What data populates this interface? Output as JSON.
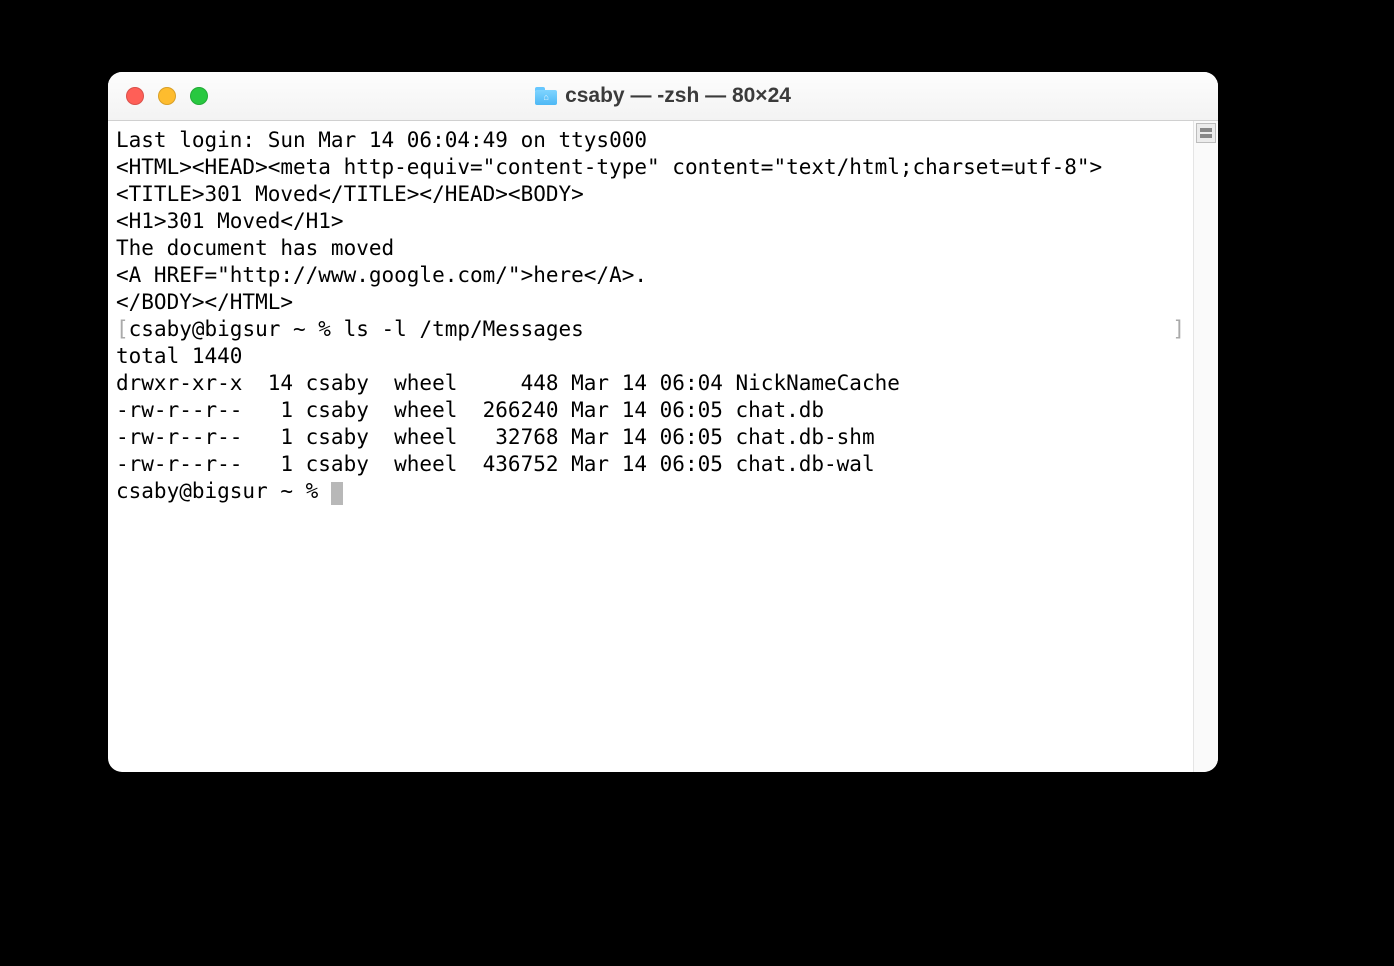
{
  "window": {
    "title": "csaby — -zsh — 80×24"
  },
  "terminal": {
    "lines": {
      "l0": "Last login: Sun Mar 14 06:04:49 on ttys000",
      "l1": "<HTML><HEAD><meta http-equiv=\"content-type\" content=\"text/html;charset=utf-8\">",
      "l2": "<TITLE>301 Moved</TITLE></HEAD><BODY>",
      "l3": "<H1>301 Moved</H1>",
      "l4": "The document has moved",
      "l5": "<A HREF=\"http://www.google.com/\">here</A>.",
      "l6": "</BODY></HTML>",
      "l7_prompt": "csaby@bigsur ~ % ",
      "l7_cmd": "ls -l /tmp/Messages",
      "l8": "total 1440",
      "l9": "drwxr-xr-x  14 csaby  wheel     448 Mar 14 06:04 NickNameCache",
      "l10": "-rw-r--r--   1 csaby  wheel  266240 Mar 14 06:05 chat.db",
      "l11": "-rw-r--r--   1 csaby  wheel   32768 Mar 14 06:05 chat.db-shm",
      "l12": "-rw-r--r--   1 csaby  wheel  436752 Mar 14 06:05 chat.db-wal",
      "l13_prompt": "csaby@bigsur ~ % "
    }
  }
}
